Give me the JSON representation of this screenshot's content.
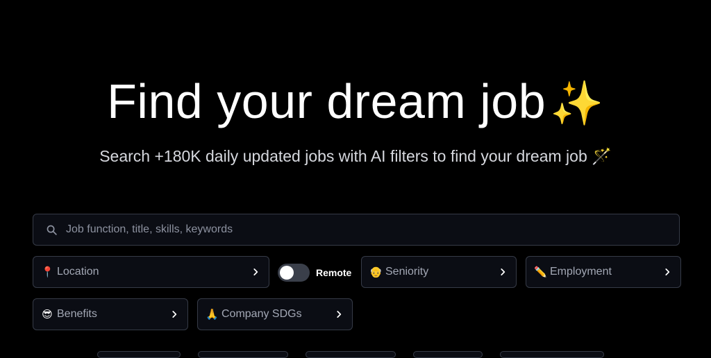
{
  "hero": {
    "title": "Find your dream job",
    "title_emoji": "✨",
    "subtitle": "Search +180K daily updated jobs with AI filters to find your dream job 🪄"
  },
  "search": {
    "placeholder": "Job function, title, skills, keywords",
    "value": "",
    "icon": "search-icon"
  },
  "filters": {
    "location": {
      "emoji": "📍",
      "label": "Location"
    },
    "remote": {
      "label": "Remote",
      "enabled": false
    },
    "seniority": {
      "emoji": "👴",
      "label": "Seniority"
    },
    "employment": {
      "emoji": "✏️",
      "label": "Employment"
    },
    "benefits": {
      "emoji": "😎",
      "label": "Benefits"
    },
    "company_sdgs": {
      "emoji": "🙏",
      "label": "Company SDGs"
    }
  },
  "colors": {
    "background": "#000000",
    "field_background": "#0b0d14",
    "border": "#363b47",
    "muted_text": "#a3a8b5"
  }
}
